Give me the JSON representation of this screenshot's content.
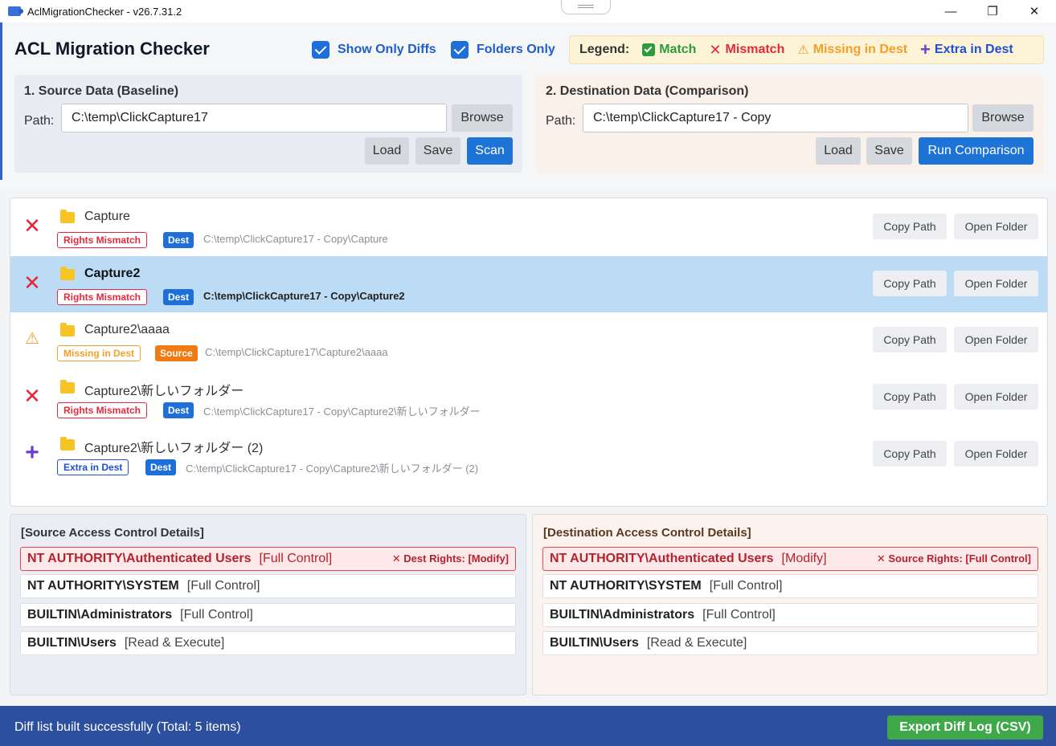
{
  "window": {
    "title": "AclMigrationChecker - v26.7.31.2",
    "minimize": "—",
    "maximize": "❐",
    "close": "✕"
  },
  "header": {
    "title": "ACL Migration Checker",
    "show_only_diffs": {
      "label": "Show Only Diffs",
      "checked": true
    },
    "folders_only": {
      "label": "Folders Only",
      "checked": true
    }
  },
  "legend": {
    "label": "Legend:",
    "items": [
      {
        "icon": "✅",
        "text": "Match",
        "color": "#2e9c3b"
      },
      {
        "icon": "✕",
        "text": "Mismatch",
        "color": "#e5283b"
      },
      {
        "icon": "⚠",
        "text": "Missing in Dest",
        "color": "#f1a02a"
      },
      {
        "icon": "+",
        "text": "Extra in Dest",
        "color": "#6a3fd1"
      }
    ]
  },
  "source": {
    "title": "1. Source Data (Baseline)",
    "path_label": "Path:",
    "path": "C:\\temp\\ClickCapture17",
    "browse": "Browse",
    "load": "Load",
    "save": "Save",
    "scan": "Scan"
  },
  "destination": {
    "title": "2. Destination Data (Comparison)",
    "path_label": "Path:",
    "path": "C:\\temp\\ClickCapture17 - Copy",
    "browse": "Browse",
    "load": "Load",
    "save": "Save",
    "run": "Run Comparison"
  },
  "rows": [
    {
      "status_icon": "✕",
      "status_color": "#e5283b",
      "name": "Capture",
      "badge": "Rights Mismatch",
      "badge_color": "#e5283b",
      "loc": "Dest",
      "loc_color": "#1e6fd9",
      "path": "C:\\temp\\ClickCapture17 - Copy\\Capture",
      "copy": "Copy Path",
      "open": "Open Folder"
    },
    {
      "status_icon": "✕",
      "status_color": "#e5283b",
      "name": "Capture2",
      "badge": "Rights Mismatch",
      "badge_color": "#e5283b",
      "loc": "Dest",
      "loc_color": "#1e6fd9",
      "path": "C:\\temp\\ClickCapture17 - Copy\\Capture2",
      "copy": "Copy Path",
      "open": "Open Folder",
      "selected": true
    },
    {
      "status_icon": "⚠",
      "status_color": "#f1a02a",
      "name": "Capture2\\aaaa",
      "badge": "Missing in Dest",
      "badge_color": "#f1a02a",
      "loc": "Source",
      "loc_color": "#f07b14",
      "path": "C:\\temp\\ClickCapture17\\Capture2\\aaaa",
      "copy": "Copy Path",
      "open": "Open Folder"
    },
    {
      "status_icon": "✕",
      "status_color": "#e5283b",
      "name": "Capture2\\新しいフォルダー",
      "badge": "Rights Mismatch",
      "badge_color": "#e5283b",
      "loc": "Dest",
      "loc_color": "#1e6fd9",
      "path": "C:\\temp\\ClickCapture17 - Copy\\Capture2\\新しいフォルダー",
      "copy": "Copy Path",
      "open": "Open Folder"
    },
    {
      "status_icon": "+",
      "status_color": "#6a3fd1",
      "name": "Capture2\\新しいフォルダー (2)",
      "badge": "Extra in Dest",
      "badge_color": "#1e4fd9",
      "loc": "Dest",
      "loc_color": "#1e6fd9",
      "path": "C:\\temp\\ClickCapture17 - Copy\\Capture2\\新しいフォルダー (2)",
      "copy": "Copy Path",
      "open": "Open Folder"
    }
  ],
  "source_acl": {
    "title": "[Source Access Control Details]",
    "entries": [
      {
        "who": "NT AUTHORITY\\Authenticated Users",
        "rights": "[Full Control]",
        "note": "✕ Dest Rights: [Modify]",
        "mismatch": true
      },
      {
        "who": "NT AUTHORITY\\SYSTEM",
        "rights": "[Full Control]"
      },
      {
        "who": "BUILTIN\\Administrators",
        "rights": "[Full Control]"
      },
      {
        "who": "BUILTIN\\Users",
        "rights": "[Read & Execute]"
      }
    ]
  },
  "dest_acl": {
    "title": "[Destination Access Control Details]",
    "entries": [
      {
        "who": "NT AUTHORITY\\Authenticated Users",
        "rights": "[Modify]",
        "note": "✕ Source Rights: [Full Control]",
        "mismatch": true
      },
      {
        "who": "NT AUTHORITY\\SYSTEM",
        "rights": "[Full Control]"
      },
      {
        "who": "BUILTIN\\Administrators",
        "rights": "[Full Control]"
      },
      {
        "who": "BUILTIN\\Users",
        "rights": "[Read & Execute]"
      }
    ]
  },
  "status": {
    "message": "Diff list built successfully (Total: 5 items)",
    "export": "Export Diff Log (CSV)"
  }
}
